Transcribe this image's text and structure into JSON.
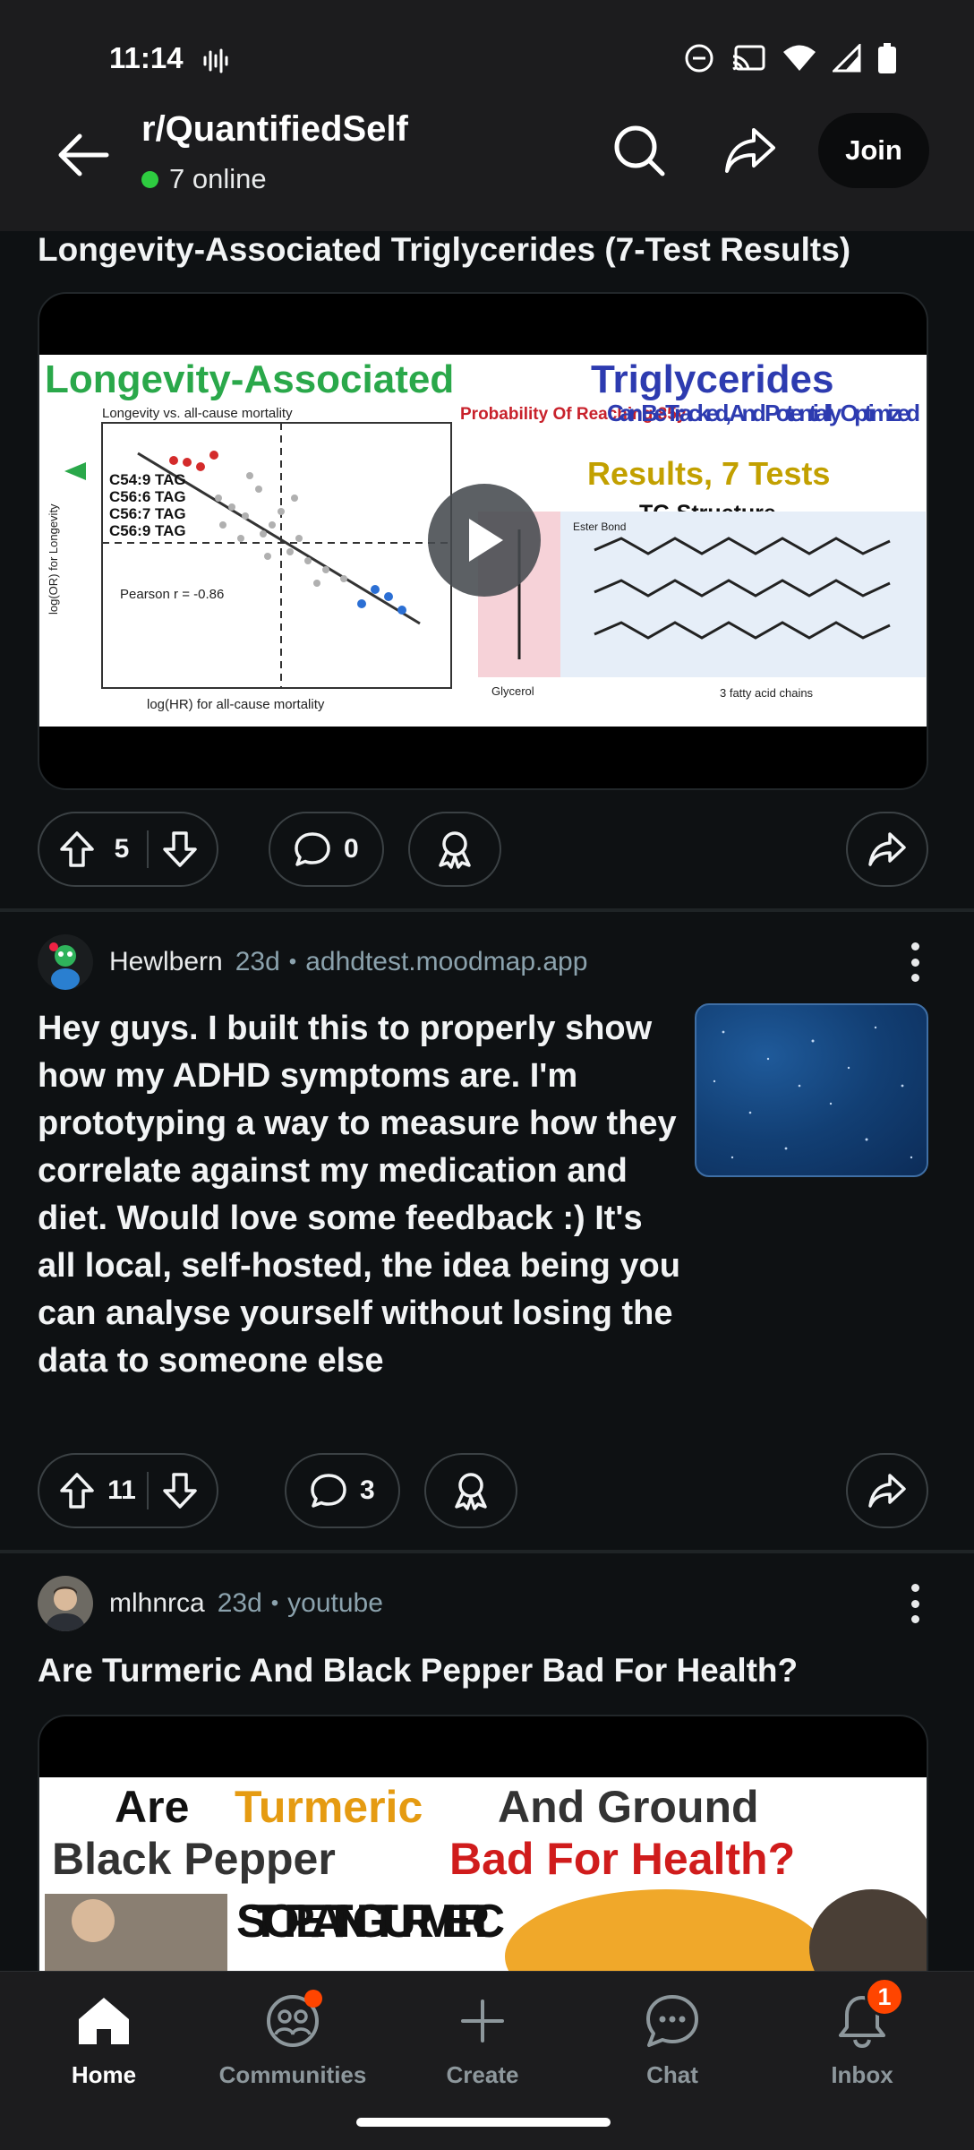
{
  "status_bar": {
    "time": "11:14"
  },
  "header": {
    "subreddit": "r/QuantifiedSelf",
    "online_text": "7 online",
    "join_label": "Join"
  },
  "posts": [
    {
      "title": "Longevity-Associated Triglycerides (7-Test Results)",
      "media": {
        "type": "video",
        "thumbnail_text": {
          "headline_green": "Longevity-Associated",
          "headline_blue": "Triglycerides",
          "sub_blue": "Can Be Tracked, And Potentially Optimized",
          "results": "Results, 7 Tests",
          "prob": "Probability Of Reaching 85y",
          "tg": "TG Structure",
          "chart_title": "Longevity vs. all-cause mortality",
          "pearson": "Pearson r = -0.86",
          "tags": [
            "C54:9 TAG",
            "C56:6 TAG",
            "C56:7 TAG",
            "C56:9 TAG"
          ],
          "xaxis": "log(HR) for all-cause mortality",
          "yaxis": "log(OR) for Longevity",
          "glycerol": "Glycerol",
          "fatty": "3 fatty acid chains",
          "ester": "Ester Bond"
        }
      },
      "upvotes": "5",
      "comments": "0"
    },
    {
      "author": "Hewlbern",
      "age": "23d",
      "domain": "adhdtest.moodmap.app",
      "body": "Hey guys. I built this to properly show how my ADHD symptoms are. I'm prototyping a way to measure how they correlate against my medication and diet. Would love some feedback :) It's all local, self-hosted, the idea being you can analyse yourself without losing the data to someone else",
      "upvotes": "11",
      "comments": "3"
    },
    {
      "author": "mlhnrca",
      "age": "23d",
      "domain": "youtube",
      "title": "Are Turmeric And Black Pepper Bad For Health?",
      "media": {
        "type": "video",
        "thumbnail_text": {
          "line1_a": "Are",
          "line1_b": "Turmeric",
          "line1_c": "And Ground",
          "line2_a": "Black Pepper",
          "line2_b": "Bad For Health?",
          "banner": "STOP EATING TURMERIC"
        }
      }
    }
  ],
  "bottom_nav": [
    {
      "label": "Home",
      "icon": "home-icon",
      "active": true
    },
    {
      "label": "Communities",
      "icon": "communities-icon"
    },
    {
      "label": "Create",
      "icon": "create-icon"
    },
    {
      "label": "Chat",
      "icon": "chat-icon"
    },
    {
      "label": "Inbox",
      "icon": "bell-icon",
      "badge": "1"
    }
  ],
  "colors": {
    "background": "#0e1113",
    "online_dot": "#2ecc40",
    "badge": "#ff4500"
  }
}
